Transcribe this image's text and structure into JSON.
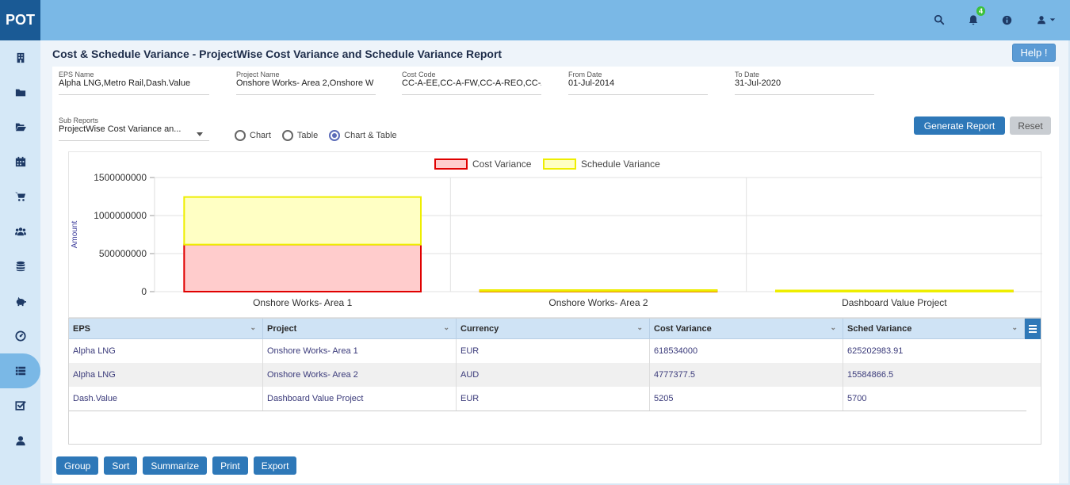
{
  "app": {
    "logo": "POT",
    "notification_count": "4"
  },
  "header_icons": [
    "search-icon",
    "bell-icon",
    "info-icon",
    "user-icon"
  ],
  "sidebar": {
    "items": [
      {
        "name": "building-icon"
      },
      {
        "name": "folder-icon"
      },
      {
        "name": "folder-open-icon"
      },
      {
        "name": "calendar-icon"
      },
      {
        "name": "cart-icon"
      },
      {
        "name": "users-icon"
      },
      {
        "name": "database-icon"
      },
      {
        "name": "piggy-bank-icon"
      },
      {
        "name": "dashboard-icon"
      },
      {
        "name": "list-icon",
        "active": true
      },
      {
        "name": "checkbox-icon"
      },
      {
        "name": "user-icon"
      }
    ]
  },
  "page": {
    "title": "Cost & Schedule Variance - ProjectWise Cost Variance and Schedule Variance Report",
    "help_label": "Help !"
  },
  "filters": {
    "eps": {
      "label": "EPS Name",
      "value": "Alpha LNG,Metro Rail,Dash.Value"
    },
    "project": {
      "label": "Project Name",
      "value": "Onshore  Works- Area 2,Onshore  W"
    },
    "cost_code": {
      "label": "Cost Code",
      "value": "CC-A-EE,CC-A-FW,CC-A-REO,CC-A-C"
    },
    "from_date": {
      "label": "From Date",
      "value": "01-Jul-2014"
    },
    "to_date": {
      "label": "To Date",
      "value": "31-Jul-2020"
    },
    "sub_reports": {
      "label": "Sub Reports",
      "value": "ProjectWise Cost Variance an..."
    }
  },
  "view_options": {
    "chart": "Chart",
    "table": "Table",
    "chart_table": "Chart & Table",
    "selected": "chart_table"
  },
  "actions": {
    "generate": "Generate Report",
    "reset": "Reset"
  },
  "chart_data": {
    "type": "bar",
    "stacked": true,
    "categories": [
      "Onshore  Works- Area 1",
      "Onshore  Works- Area 2",
      "Dashboard Value Project"
    ],
    "series": [
      {
        "name": "Cost Variance",
        "values": [
          618534000,
          4777377.5,
          5205
        ],
        "fill": "#ffcccc",
        "stroke": "#e00000"
      },
      {
        "name": "Schedule Variance",
        "values": [
          625202983.91,
          15584866.5,
          5700
        ],
        "fill": "#ffffc4",
        "stroke": "#eeee00"
      }
    ],
    "ylabel": "Amount",
    "ylim": [
      0,
      1500000000
    ],
    "yticks": [
      "0",
      "500000000",
      "1000000000",
      "1500000000"
    ],
    "legend_position": "top-center",
    "grid": true
  },
  "table": {
    "columns": [
      "EPS",
      "Project",
      "Currency",
      "Cost Variance",
      "Sched Variance"
    ],
    "rows": [
      [
        "Alpha LNG",
        "Onshore Works- Area 1",
        "EUR",
        "618534000",
        "625202983.91"
      ],
      [
        "Alpha LNG",
        "Onshore Works- Area 2",
        "AUD",
        "4777377.5",
        "15584866.5"
      ],
      [
        "Dash.Value",
        "Dashboard Value Project",
        "EUR",
        "5205",
        "5700"
      ]
    ]
  },
  "footer_buttons": [
    "Group",
    "Sort",
    "Summarize",
    "Print",
    "Export"
  ]
}
